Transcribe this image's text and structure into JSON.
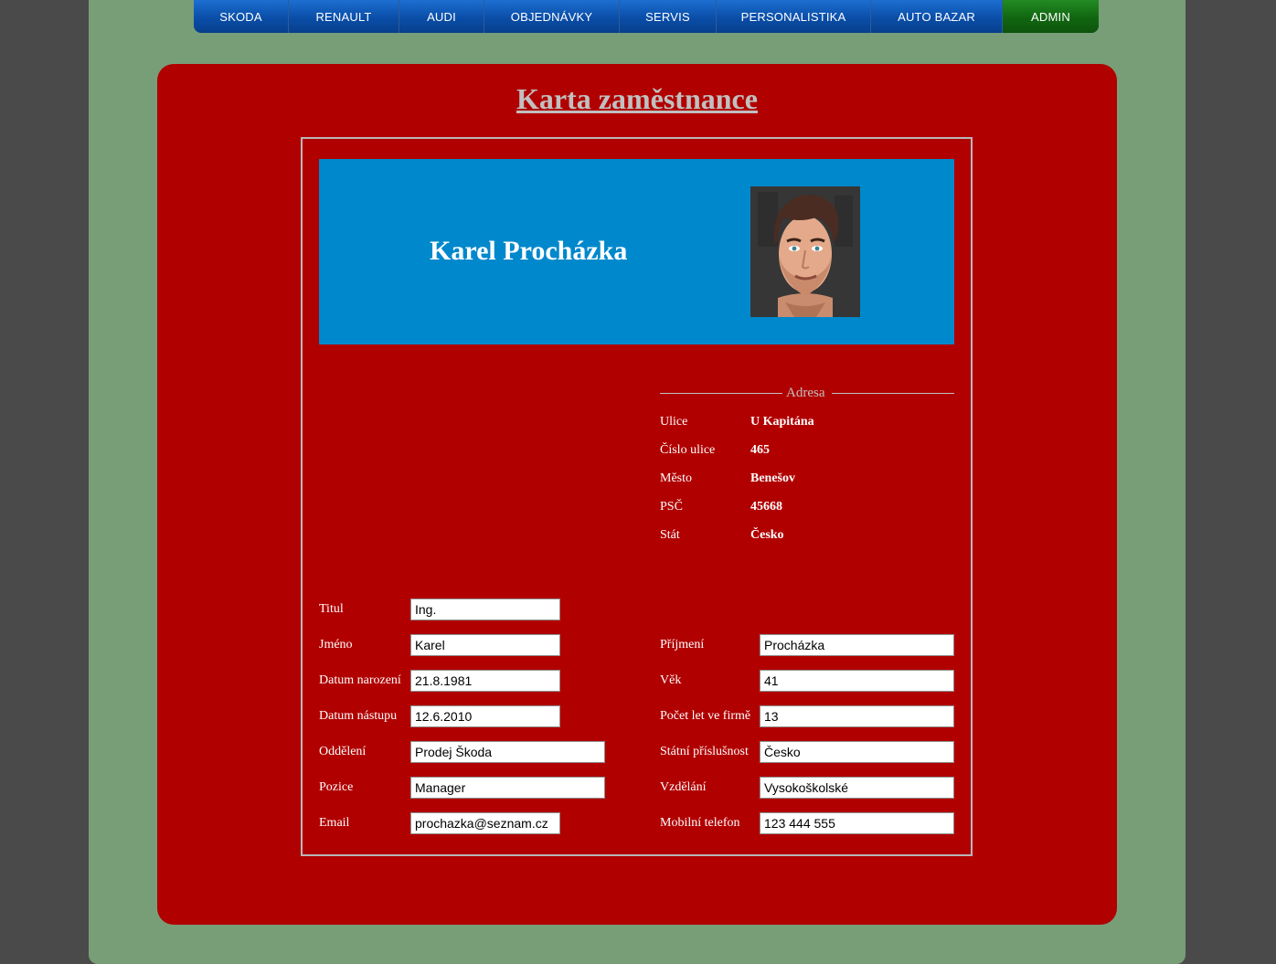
{
  "nav": {
    "items": [
      {
        "label": "SKODA"
      },
      {
        "label": "RENAULT"
      },
      {
        "label": "AUDI"
      },
      {
        "label": "OBJEDNÁVKY"
      },
      {
        "label": "SERVIS"
      },
      {
        "label": "PERSONALISTIKA"
      },
      {
        "label": "AUTO BAZAR"
      },
      {
        "label": "ADMIN"
      }
    ]
  },
  "page": {
    "title": "Karta zaměstnance"
  },
  "employee": {
    "name": "Karel Procházka",
    "avatar_icon": "portrait-avatar"
  },
  "address": {
    "legend": "Adresa",
    "rows": [
      {
        "label": "Ulice",
        "value": "U Kapitána"
      },
      {
        "label": "Číslo ulice",
        "value": "465"
      },
      {
        "label": "Město",
        "value": "Benešov"
      },
      {
        "label": "PSČ",
        "value": "45668"
      },
      {
        "label": "Stát",
        "value": "Česko"
      }
    ]
  },
  "form": {
    "left": [
      {
        "label": "Titul",
        "value": "Ing."
      },
      {
        "label": "Jméno",
        "value": "Karel"
      },
      {
        "label": "Datum narození",
        "value": "21.8.1981"
      },
      {
        "label": "Datum nástupu",
        "value": "12.6.2010"
      },
      {
        "label": "Oddělení",
        "value": "Prodej Škoda"
      },
      {
        "label": "Pozice",
        "value": "Manager"
      },
      {
        "label": "Email",
        "value": "prochazka@seznam.cz"
      }
    ],
    "right": [
      {
        "label": "Příjmení",
        "value": "Procházka"
      },
      {
        "label": "Věk",
        "value": "41"
      },
      {
        "label": "Počet let ve firmě",
        "value": "13"
      },
      {
        "label": "Státní příslušnost",
        "value": "Česko"
      },
      {
        "label": "Vzdělání",
        "value": "Vysokoškolské"
      },
      {
        "label": "Mobilní telefon",
        "value": "123 444 555"
      }
    ]
  },
  "colors": {
    "background": "#4a4a4a",
    "page": "#789e78",
    "card": "#b10000",
    "header": "#0088cc",
    "nav": "#0a4ea8",
    "nav_active": "#116611"
  }
}
